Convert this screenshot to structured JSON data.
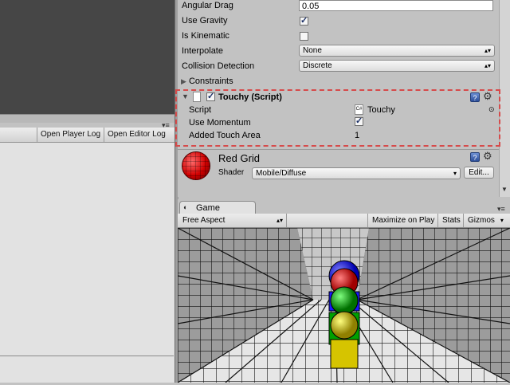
{
  "inspector": {
    "rigidbody": {
      "angular_drag_label": "Angular Drag",
      "angular_drag_value": "0.05",
      "use_gravity_label": "Use Gravity",
      "use_gravity_checked": true,
      "is_kinematic_label": "Is Kinematic",
      "is_kinematic_checked": false,
      "interpolate_label": "Interpolate",
      "interpolate_value": "None",
      "collision_detection_label": "Collision Detection",
      "collision_detection_value": "Discrete",
      "constraints_label": "Constraints"
    },
    "touchy": {
      "title": "Touchy (Script)",
      "enabled": true,
      "script_label": "Script",
      "script_value": "Touchy",
      "use_momentum_label": "Use Momentum",
      "use_momentum_checked": true,
      "added_touch_area_label": "Added Touch Area",
      "added_touch_area_value": "1"
    },
    "material": {
      "name": "Red Grid",
      "shader_label": "Shader",
      "shader_value": "Mobile/Diffuse",
      "edit_label": "Edit..."
    }
  },
  "console": {
    "open_player_log": "Open Player Log",
    "open_editor_log": "Open Editor Log"
  },
  "game": {
    "tab_label": "Game",
    "aspect": "Free Aspect",
    "maximize_on_play": "Maximize on Play",
    "stats": "Stats",
    "gizmos": "Gizmos"
  },
  "colors": {
    "highlight_dashed": "#d64b4b",
    "sphere_blue": "#1a1aff",
    "sphere_red": "#e00000",
    "sphere_green": "#00b000",
    "sphere_yellow": "#e0d000"
  }
}
